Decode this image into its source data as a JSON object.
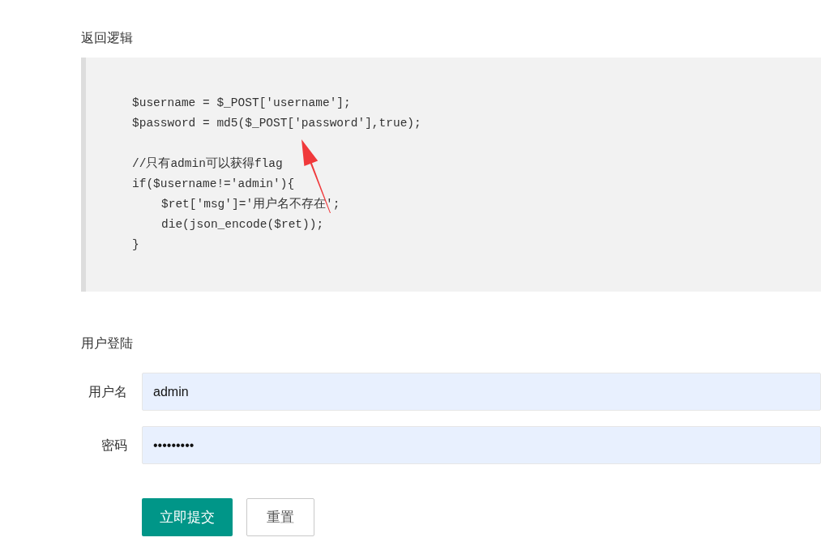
{
  "logic": {
    "title": "返回逻辑",
    "code": [
      {
        "lines": [
          {
            "text": "$username = $_POST['username'];"
          },
          {
            "text": "$password = md5($_POST['password'],true);"
          }
        ]
      },
      {
        "lines": [
          {
            "text": "//只有admin可以获得flag"
          },
          {
            "text": "if($username!='admin'){",
            "children": [
              {
                "text": "$ret['msg']='用户名不存在';"
              },
              {
                "text": "die(json_encode($ret));"
              }
            ]
          },
          {
            "text": "}"
          }
        ]
      }
    ]
  },
  "login": {
    "title": "用户登陆",
    "fields": [
      {
        "label": "用户名",
        "kind": "text",
        "value": "admin"
      },
      {
        "label": "密码",
        "kind": "password",
        "value": "•••••••••"
      }
    ],
    "buttons": [
      {
        "label": "立即提交",
        "kind": "primary"
      },
      {
        "label": "重置",
        "kind": "secondary"
      }
    ]
  }
}
